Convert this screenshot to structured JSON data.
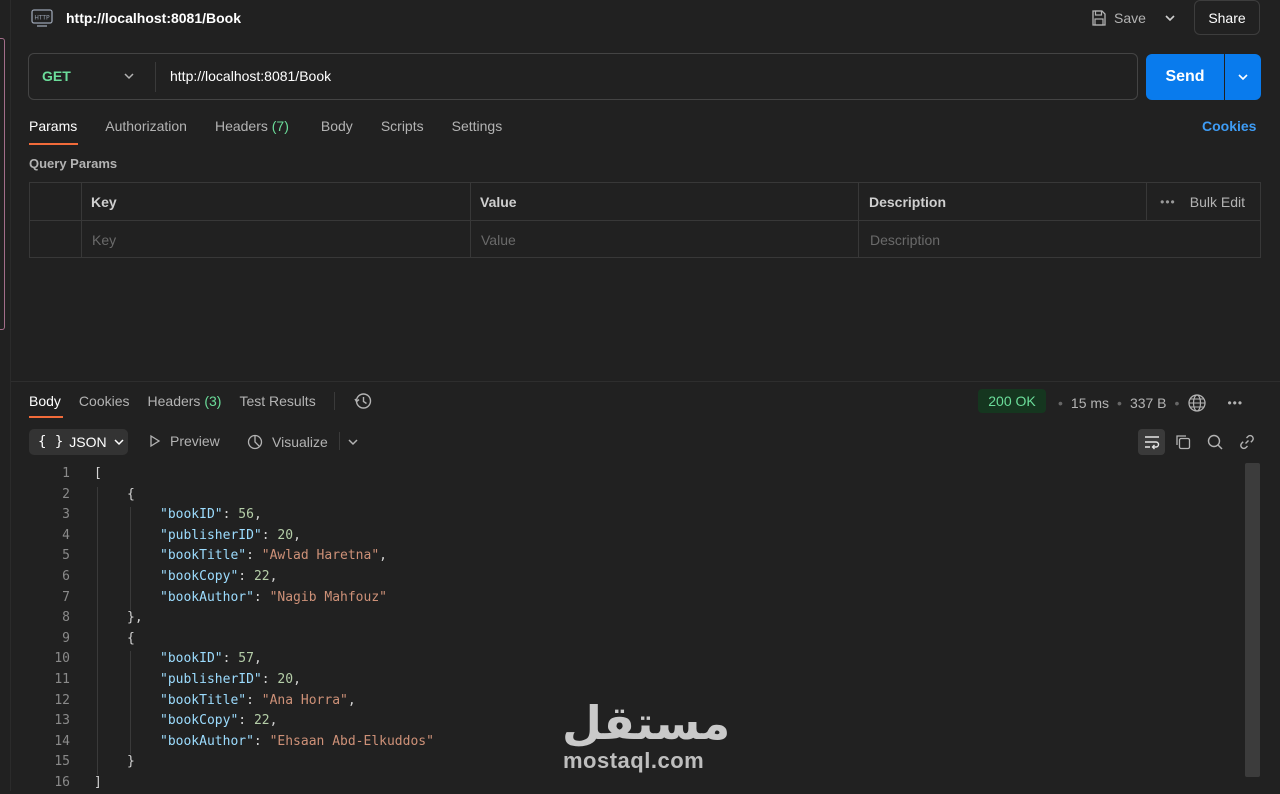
{
  "request": {
    "title": "http://localhost:8081/Book",
    "save_label": "Save",
    "share_label": "Share",
    "method": "GET",
    "url": "http://localhost:8081/Book",
    "send_label": "Send"
  },
  "request_tabs": {
    "params": "Params",
    "authorization": "Authorization",
    "headers": "Headers",
    "headers_count": "(7)",
    "body": "Body",
    "scripts": "Scripts",
    "settings": "Settings",
    "cookies": "Cookies"
  },
  "query_params": {
    "label": "Query Params",
    "columns": {
      "key": "Key",
      "value": "Value",
      "description": "Description"
    },
    "bulk_edit": "Bulk Edit",
    "placeholders": {
      "key": "Key",
      "value": "Value",
      "description": "Description"
    }
  },
  "response_tabs": {
    "body": "Body",
    "cookies": "Cookies",
    "headers": "Headers",
    "headers_count": "(3)",
    "test_results": "Test Results"
  },
  "response_meta": {
    "status": "200 OK",
    "time": "15 ms",
    "size": "337 B"
  },
  "view": {
    "format": "JSON",
    "format_icon": "{ }",
    "preview": "Preview",
    "visualize": "Visualize"
  },
  "code_lines": [
    "[",
    "{",
    "\"bookID\": 56,",
    "\"publisherID\": 20,",
    "\"bookTitle\": \"Awlad Haretna\",",
    "\"bookCopy\": 22,",
    "\"bookAuthor\": \"Nagib Mahfouz\"",
    "},",
    "{",
    "\"bookID\": 57,",
    "\"publisherID\": 20,",
    "\"bookTitle\": \"Ana Horra\",",
    "\"bookCopy\": 22,",
    "\"bookAuthor\": \"Ehsaan Abd-Elkuddos\"",
    "}",
    "]"
  ],
  "watermark": {
    "logo": "مستقل",
    "text": "mostaql.com"
  },
  "colors": {
    "accent": "#097bed",
    "success": "#6bdd9a",
    "tab_underline": "#f26b3a"
  }
}
